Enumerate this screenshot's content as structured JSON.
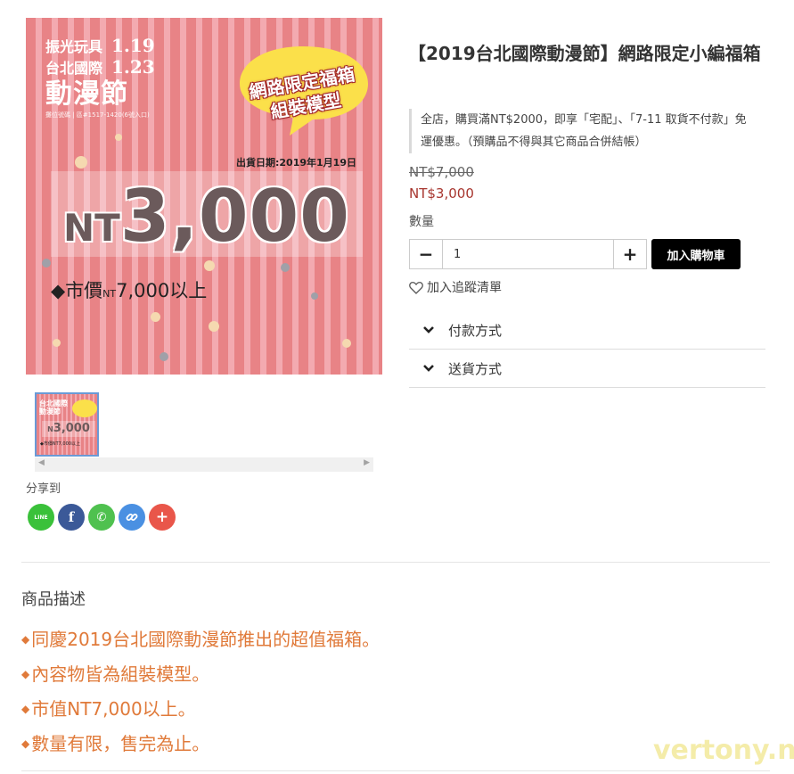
{
  "image": {
    "brand_line1": "振光玩具",
    "brand_date1": "1.19",
    "brand_line2": "台北國際",
    "brand_date2": "1.23",
    "brand_big": "動漫節",
    "booth": "攤位號碼 | 區#1517-1420(6號入口)",
    "bubble_line1": "網路限定福箱",
    "bubble_line2": "組裝模型",
    "ship_date": "出貨日期:2019年1月19日",
    "price_prefix": "NT",
    "price_number": "3,000",
    "market_prefix": "◆市價",
    "market_nt": "NT",
    "market_value": "7,000以上"
  },
  "thumbnail": {
    "title_line1": "台北國際",
    "title_line2": "動漫節",
    "price": "3,000",
    "market": "◆市價NT7,000以上"
  },
  "share": {
    "label": "分享到",
    "buttons": [
      {
        "name": "line",
        "glyph": "LINE",
        "color": "#3ac13a"
      },
      {
        "name": "facebook",
        "glyph": "f",
        "color": "#3b5998"
      },
      {
        "name": "whatsapp",
        "glyph": "✆",
        "color": "#4fc14f"
      },
      {
        "name": "link",
        "glyph": "🔗",
        "color": "#4a90e2"
      },
      {
        "name": "more",
        "glyph": "+",
        "color": "#e9564a"
      }
    ]
  },
  "product": {
    "title": "【2019台北國際動漫節】網路限定小編福箱",
    "promo": "全店，購買滿NT$2000，即享「宅配」、「7-11 取貨不付款」免運優惠。（預購品不得與其它商品合併結帳）",
    "original_price": "NT$7,000",
    "sale_price": "NT$3,000",
    "quantity_label": "數量",
    "quantity_value": "1",
    "minus": "−",
    "plus": "+",
    "add_to_cart": "加入購物車",
    "wishlist": "加入追蹤清單"
  },
  "accordion": [
    {
      "label": "付款方式"
    },
    {
      "label": "送貨方式"
    }
  ],
  "description": {
    "heading": "商品描述",
    "items": [
      "同慶2019台北國際動漫節推出的超值福箱。",
      "內容物皆為組裝模型。",
      "市值NT7,000以上。",
      "數量有限，售完為止。"
    ],
    "bullet": "◆"
  },
  "watermark": "vertony.net"
}
